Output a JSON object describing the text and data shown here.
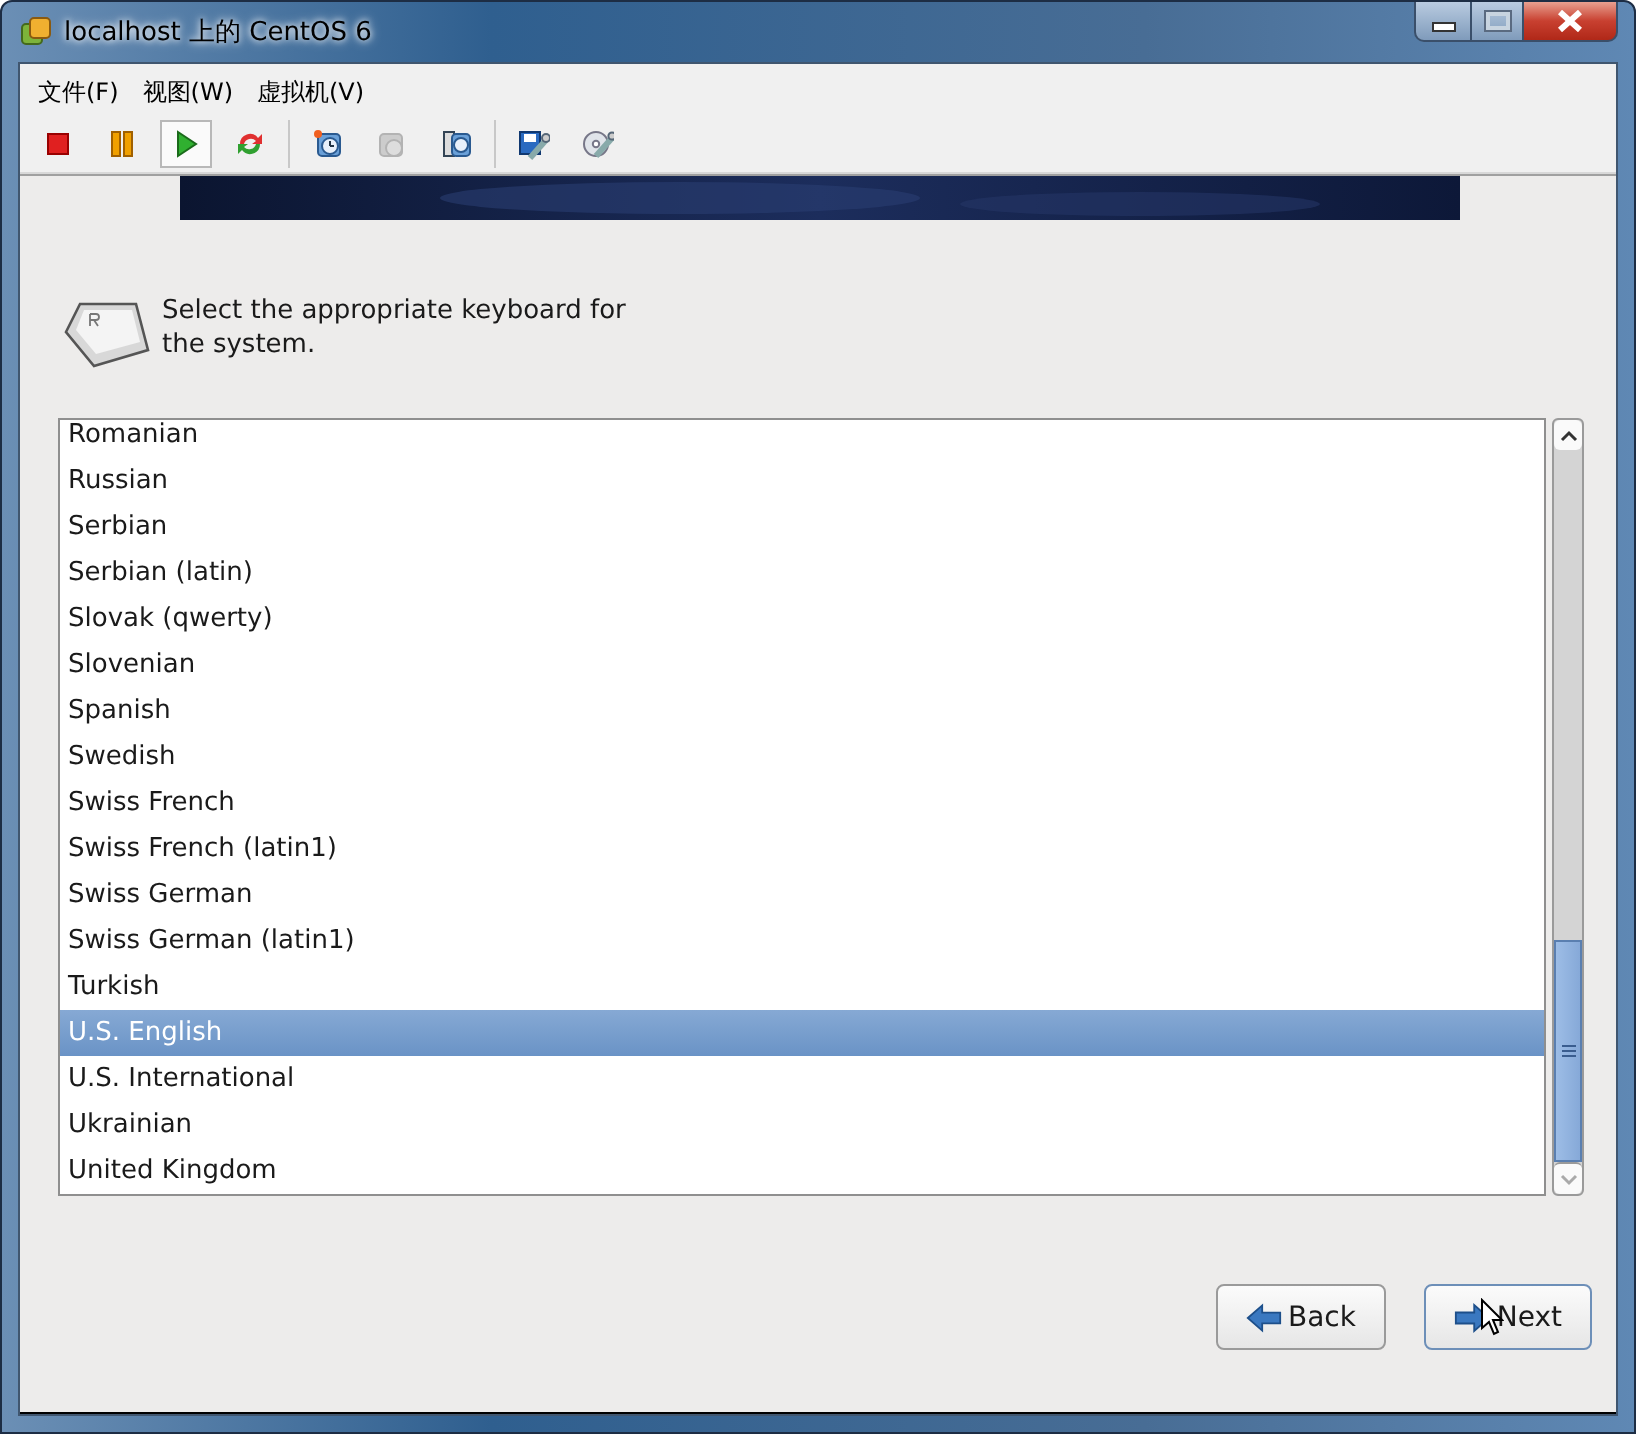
{
  "window": {
    "title": "localhost 上的 CentOS 6"
  },
  "menu": [
    {
      "label": "文件(F)"
    },
    {
      "label": "视图(W)"
    },
    {
      "label": "虚拟机(V)"
    }
  ],
  "toolbar": [
    {
      "kind": "stop",
      "selected": false,
      "disabled": false
    },
    {
      "kind": "pause",
      "selected": false,
      "disabled": false
    },
    {
      "kind": "play",
      "selected": true,
      "disabled": false
    },
    {
      "kind": "restart",
      "selected": false,
      "disabled": false
    },
    {
      "kind": "snapshot",
      "selected": false,
      "disabled": false
    },
    {
      "kind": "revert",
      "selected": false,
      "disabled": true
    },
    {
      "kind": "manage",
      "selected": false,
      "disabled": false
    },
    {
      "kind": "settings",
      "selected": false,
      "disabled": false
    },
    {
      "kind": "disc",
      "selected": false,
      "disabled": false
    }
  ],
  "prompt": "Select the appropriate keyboard for the system.",
  "keyboards": [
    {
      "label": "Romanian",
      "selected": false
    },
    {
      "label": "Russian",
      "selected": false
    },
    {
      "label": "Serbian",
      "selected": false
    },
    {
      "label": "Serbian (latin)",
      "selected": false
    },
    {
      "label": "Slovak (qwerty)",
      "selected": false
    },
    {
      "label": "Slovenian",
      "selected": false
    },
    {
      "label": "Spanish",
      "selected": false
    },
    {
      "label": "Swedish",
      "selected": false
    },
    {
      "label": "Swiss French",
      "selected": false
    },
    {
      "label": "Swiss French (latin1)",
      "selected": false
    },
    {
      "label": "Swiss German",
      "selected": false
    },
    {
      "label": "Swiss German (latin1)",
      "selected": false
    },
    {
      "label": "Turkish",
      "selected": false
    },
    {
      "label": "U.S. English",
      "selected": true
    },
    {
      "label": "U.S. International",
      "selected": false
    },
    {
      "label": "Ukrainian",
      "selected": false
    },
    {
      "label": "United Kingdom",
      "selected": false
    }
  ],
  "buttons": [
    {
      "label": "Back",
      "kind": "back"
    },
    {
      "label": "Next",
      "kind": "next"
    }
  ]
}
